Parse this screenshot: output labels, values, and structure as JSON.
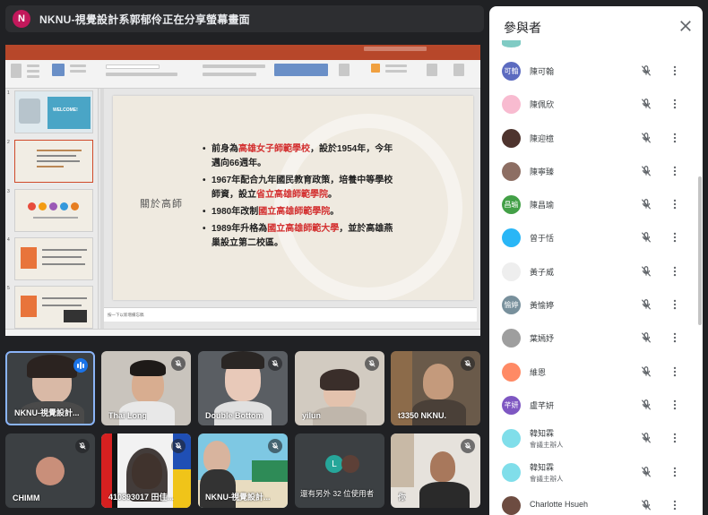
{
  "banner": {
    "avatar_letter": "N",
    "text": "NKNU-視覺設計系郭郁伶正在分享螢幕畫面"
  },
  "slide": {
    "left_title": "關於高師",
    "bullets": [
      {
        "pre": "前身為",
        "hl": "高雄女子師範學校",
        "post": "，設於1954年，今年邁向66週年。"
      },
      {
        "pre": "1967年配合九年國民教育政策，培養中等學校師資，設立",
        "hl": "省立高雄師範學院",
        "post": "。"
      },
      {
        "pre": "1980年改制",
        "hl": "國立高雄師範學院",
        "post": "。"
      },
      {
        "pre": "1989年升格為",
        "hl": "國立高雄師範大學",
        "post": "，並於高雄燕 巢設立第二校區。"
      }
    ],
    "thumb_numbers": [
      "1",
      "2",
      "3",
      "4",
      "5"
    ],
    "thumb1_text": "WELCOME!",
    "notes": "按一下以新增備忘稿"
  },
  "tiles": [
    {
      "name": "NKNU-視覺設計...",
      "speaking": true
    },
    {
      "name": "Thai Long",
      "speaking": false
    },
    {
      "name": "Double Bottom",
      "speaking": false
    },
    {
      "name": "yilun",
      "speaking": false
    },
    {
      "name": "t3350 NKNU.",
      "speaking": false
    },
    {
      "name": "CHIMM",
      "speaking": false
    },
    {
      "name": "410893017 田佳...",
      "speaking": false
    },
    {
      "name": "NKNU-視覺設計...",
      "speaking": false
    },
    {
      "name": "還有另外 32 位使用者",
      "speaking": false,
      "avatar_letter": "L"
    },
    {
      "name": "你",
      "speaking": false
    }
  ],
  "panel": {
    "title": "參與者",
    "participants": [
      {
        "name": "陳可翰",
        "avatar_text": "可翰",
        "avatar_color": "#5c6bc0",
        "role": ""
      },
      {
        "name": "陳佩欣",
        "avatar_text": "",
        "avatar_color": "#f8bbd0",
        "role": ""
      },
      {
        "name": "陳迎檍",
        "avatar_text": "",
        "avatar_color": "#4e342e",
        "role": ""
      },
      {
        "name": "陳寧臻",
        "avatar_text": "",
        "avatar_color": "#8d6e63",
        "role": ""
      },
      {
        "name": "陳昌瑜",
        "avatar_text": "昌瑜",
        "avatar_color": "#43a047",
        "role": ""
      },
      {
        "name": "曾于恬",
        "avatar_text": "",
        "avatar_color": "#29b6f6",
        "role": ""
      },
      {
        "name": "黃子威",
        "avatar_text": "",
        "avatar_color": "#eeeeee",
        "role": ""
      },
      {
        "name": "黃愉婷",
        "avatar_text": "愉婷",
        "avatar_color": "#78909c",
        "role": ""
      },
      {
        "name": "葉嫣妤",
        "avatar_text": "",
        "avatar_color": "#9e9e9e",
        "role": ""
      },
      {
        "name": "維恩",
        "avatar_text": "",
        "avatar_color": "#ff8a65",
        "role": ""
      },
      {
        "name": "盧芊妍",
        "avatar_text": "芊妍",
        "avatar_color": "#7e57c2",
        "role": ""
      },
      {
        "name": "韓知霖",
        "avatar_text": "",
        "avatar_color": "#80deea",
        "role": "會議主辦人"
      },
      {
        "name": "韓知霖",
        "avatar_text": "",
        "avatar_color": "#80deea",
        "role": "會議主辦人"
      },
      {
        "name": "Charlotte Hsueh",
        "avatar_text": "",
        "avatar_color": "#6d4c41",
        "role": ""
      }
    ]
  },
  "colors": {
    "background": "#202124",
    "accent": "#1a73e8",
    "highlight_red": "#d32f2f",
    "ppt_brand": "#b7472a"
  }
}
